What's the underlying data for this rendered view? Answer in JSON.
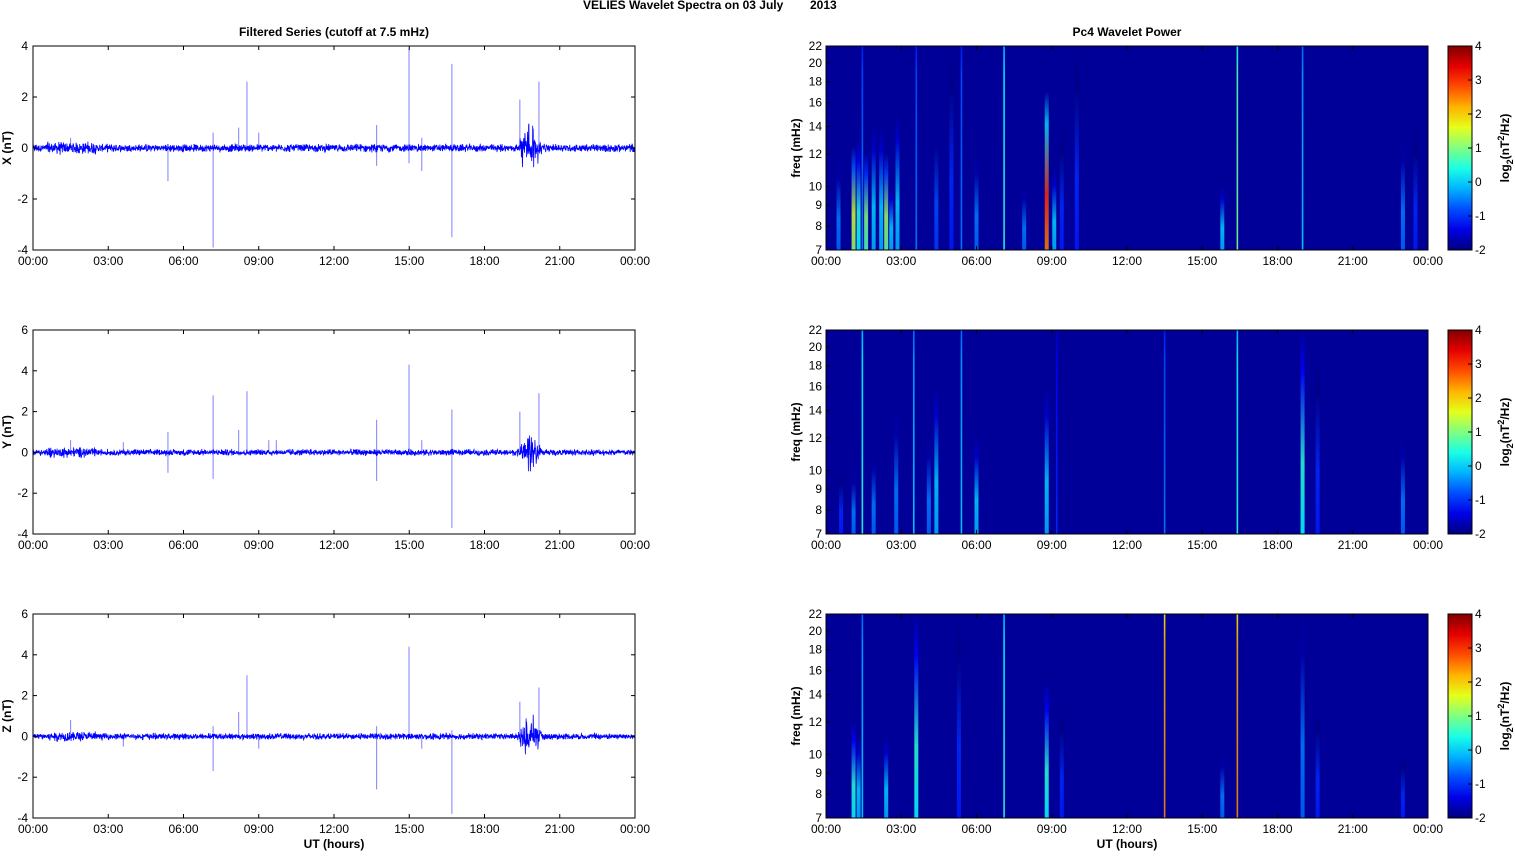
{
  "title": {
    "main": "VELIES Wavelet Spectra on 03 July",
    "year": "2013"
  },
  "chart_data": [
    {
      "type": "line",
      "title": "Filtered Series (cutoff at 7.5 mHz)",
      "ylabel": "X (nT)",
      "xlabel": "",
      "xlim": [
        0,
        24
      ],
      "ylim": [
        -4,
        4
      ],
      "yticks": [
        -4,
        -2,
        0,
        2,
        4
      ],
      "xticks": [
        "00:00",
        "03:00",
        "06:00",
        "09:00",
        "12:00",
        "15:00",
        "18:00",
        "21:00",
        "00:00"
      ],
      "color": "#0000ff",
      "noise_amplitude": 0.12,
      "spikes": [
        [
          1.5,
          0.4
        ],
        [
          5.38,
          -1.3
        ],
        [
          7.18,
          -3.9
        ],
        [
          7.18,
          0.6
        ],
        [
          8.2,
          0.8
        ],
        [
          8.53,
          2.6
        ],
        [
          9.0,
          0.6
        ],
        [
          13.7,
          0.9
        ],
        [
          13.7,
          -0.7
        ],
        [
          14.99,
          3.9
        ],
        [
          14.99,
          -0.6
        ],
        [
          15.5,
          -0.9
        ],
        [
          15.5,
          0.4
        ],
        [
          16.7,
          3.3
        ],
        [
          16.7,
          -3.5
        ],
        [
          19.41,
          1.9
        ],
        [
          20.17,
          2.6
        ]
      ],
      "burst": [
        19.3,
        20.3,
        0.9
      ]
    },
    {
      "type": "line",
      "title": "",
      "ylabel": "Y (nT)",
      "xlabel": "",
      "xlim": [
        0,
        24
      ],
      "ylim": [
        -4,
        6
      ],
      "yticks": [
        -4,
        -2,
        0,
        2,
        4,
        6
      ],
      "xticks": [
        "00:00",
        "03:00",
        "06:00",
        "09:00",
        "12:00",
        "15:00",
        "18:00",
        "21:00",
        "00:00"
      ],
      "color": "#0000ff",
      "noise_amplitude": 0.12,
      "spikes": [
        [
          1.5,
          0.6
        ],
        [
          3.6,
          0.5
        ],
        [
          5.38,
          1.0
        ],
        [
          5.38,
          -1.0
        ],
        [
          7.18,
          2.8
        ],
        [
          7.18,
          -1.3
        ],
        [
          8.2,
          1.1
        ],
        [
          8.53,
          3.0
        ],
        [
          9.4,
          0.6
        ],
        [
          9.7,
          0.6
        ],
        [
          13.7,
          1.6
        ],
        [
          13.7,
          -1.4
        ],
        [
          14.99,
          4.3
        ],
        [
          15.5,
          0.6
        ],
        [
          16.7,
          2.1
        ],
        [
          16.7,
          -3.7
        ],
        [
          19.41,
          2.0
        ],
        [
          20.17,
          2.9
        ]
      ],
      "burst": [
        19.3,
        20.3,
        0.9
      ]
    },
    {
      "type": "line",
      "title": "",
      "ylabel": "Z (nT)",
      "xlabel": "UT (hours)",
      "xlim": [
        0,
        24
      ],
      "ylim": [
        -4,
        6
      ],
      "yticks": [
        -4,
        -2,
        0,
        2,
        4,
        6
      ],
      "xticks": [
        "00:00",
        "03:00",
        "06:00",
        "09:00",
        "12:00",
        "15:00",
        "18:00",
        "21:00",
        "00:00"
      ],
      "color": "#0000ff",
      "noise_amplitude": 0.12,
      "spikes": [
        [
          1.5,
          0.8
        ],
        [
          3.6,
          -0.5
        ],
        [
          7.18,
          -1.7
        ],
        [
          7.18,
          0.5
        ],
        [
          8.2,
          1.2
        ],
        [
          8.53,
          3.0
        ],
        [
          9.0,
          -0.6
        ],
        [
          13.7,
          -2.6
        ],
        [
          13.7,
          0.5
        ],
        [
          14.99,
          4.4
        ],
        [
          15.5,
          -0.6
        ],
        [
          16.7,
          -3.8
        ],
        [
          16.7,
          0.3
        ],
        [
          19.41,
          1.7
        ],
        [
          20.17,
          2.4
        ]
      ],
      "burst": [
        19.3,
        20.3,
        0.9
      ]
    },
    {
      "type": "heatmap",
      "title": "Pc4 Wavelet Power",
      "ylabel": "freq (mHz)",
      "xlabel": "",
      "xlim": [
        0,
        24
      ],
      "ylim": [
        7,
        22
      ],
      "yscale": "log",
      "yticks": [
        7,
        8,
        9,
        10,
        12,
        14,
        16,
        18,
        20,
        22
      ],
      "xticks": [
        "00:00",
        "03:00",
        "06:00",
        "09:00",
        "12:00",
        "15:00",
        "18:00",
        "21:00",
        "00:00"
      ],
      "clim": [
        -2,
        4
      ],
      "cticks": [
        -2,
        -1,
        0,
        1,
        2,
        3,
        4
      ],
      "events": [
        [
          0.5,
          11.5,
          -0.5
        ],
        [
          1.1,
          12.5,
          1.5
        ],
        [
          1.3,
          13,
          0.5
        ],
        [
          1.45,
          22,
          -0.5,
          1
        ],
        [
          1.6,
          12,
          1.0
        ],
        [
          1.9,
          14,
          0
        ],
        [
          2.2,
          14,
          0
        ],
        [
          2.4,
          12,
          1.2
        ],
        [
          2.6,
          10,
          0
        ],
        [
          2.85,
          15,
          0
        ],
        [
          3.6,
          22,
          -0.5,
          1
        ],
        [
          4.4,
          14.5,
          -0.8
        ],
        [
          5.0,
          22,
          -1
        ],
        [
          5.4,
          22,
          -0.5,
          1
        ],
        [
          6.0,
          12,
          -0.5
        ],
        [
          7.1,
          22,
          0.5,
          1
        ],
        [
          7.9,
          10,
          -0.5
        ],
        [
          8.8,
          17,
          3
        ],
        [
          9.1,
          11,
          0
        ],
        [
          9.4,
          14,
          -1
        ],
        [
          10.0,
          22,
          -1
        ],
        [
          15.8,
          10,
          0
        ],
        [
          16.4,
          22,
          1,
          1
        ],
        [
          19.0,
          22,
          0,
          1
        ],
        [
          23.0,
          13,
          -0.5
        ],
        [
          23.5,
          14,
          -1
        ]
      ]
    },
    {
      "type": "heatmap",
      "title": "",
      "ylabel": "freq (mHz)",
      "xlabel": "",
      "xlim": [
        0,
        24
      ],
      "ylim": [
        7,
        22
      ],
      "yscale": "log",
      "yticks": [
        7,
        8,
        9,
        10,
        12,
        14,
        16,
        18,
        20,
        22
      ],
      "xticks": [
        "00:00",
        "03:00",
        "06:00",
        "09:00",
        "12:00",
        "15:00",
        "18:00",
        "21:00",
        "00:00"
      ],
      "clim": [
        -2,
        4
      ],
      "cticks": [
        -2,
        -1,
        0,
        1,
        2,
        3,
        4
      ],
      "events": [
        [
          0.6,
          10,
          -1
        ],
        [
          1.1,
          10,
          -0.5
        ],
        [
          1.45,
          22,
          0.5,
          1
        ],
        [
          1.9,
          11,
          -0.5
        ],
        [
          2.8,
          14,
          -0.5
        ],
        [
          3.5,
          22,
          0,
          1
        ],
        [
          4.1,
          12,
          -0.5
        ],
        [
          4.4,
          16,
          0
        ],
        [
          5.4,
          22,
          0,
          1
        ],
        [
          6.0,
          12,
          0
        ],
        [
          8.8,
          16,
          0
        ],
        [
          9.2,
          22,
          -1,
          1
        ],
        [
          13.5,
          22,
          -0.5,
          1
        ],
        [
          16.4,
          22,
          0.5,
          1
        ],
        [
          19.0,
          22,
          0.5
        ],
        [
          19.6,
          19,
          -1
        ],
        [
          23.0,
          12,
          -0.5
        ]
      ]
    },
    {
      "type": "heatmap",
      "title": "",
      "ylabel": "freq (mHz)",
      "xlabel": "UT (hours)",
      "xlim": [
        0,
        24
      ],
      "ylim": [
        7,
        22
      ],
      "yscale": "log",
      "yticks": [
        7,
        8,
        9,
        10,
        12,
        14,
        16,
        18,
        20,
        22
      ],
      "xticks": [
        "00:00",
        "03:00",
        "06:00",
        "09:00",
        "12:00",
        "15:00",
        "18:00",
        "21:00",
        "00:00"
      ],
      "clim": [
        -2,
        4
      ],
      "cticks": [
        -2,
        -1,
        0,
        1,
        2,
        3,
        4
      ],
      "events": [
        [
          1.1,
          12,
          0.5
        ],
        [
          1.3,
          11,
          0
        ],
        [
          1.45,
          22,
          0,
          1
        ],
        [
          2.4,
          11,
          0
        ],
        [
          3.6,
          22,
          0.5
        ],
        [
          5.3,
          22,
          -1
        ],
        [
          7.1,
          22,
          0.5,
          1
        ],
        [
          8.8,
          15,
          0.5
        ],
        [
          9.4,
          13,
          -1
        ],
        [
          13.5,
          22,
          2.5,
          1
        ],
        [
          15.8,
          10,
          -0.5
        ],
        [
          16.4,
          22,
          2.5,
          1
        ],
        [
          19.0,
          22,
          -0.5
        ],
        [
          19.6,
          13,
          -1
        ],
        [
          23.0,
          10,
          -1
        ]
      ]
    }
  ],
  "colorbar_label": {
    "base": "log",
    "sub": "2",
    "mid": "(nT",
    "sup": "2",
    "end": "/Hz)"
  }
}
